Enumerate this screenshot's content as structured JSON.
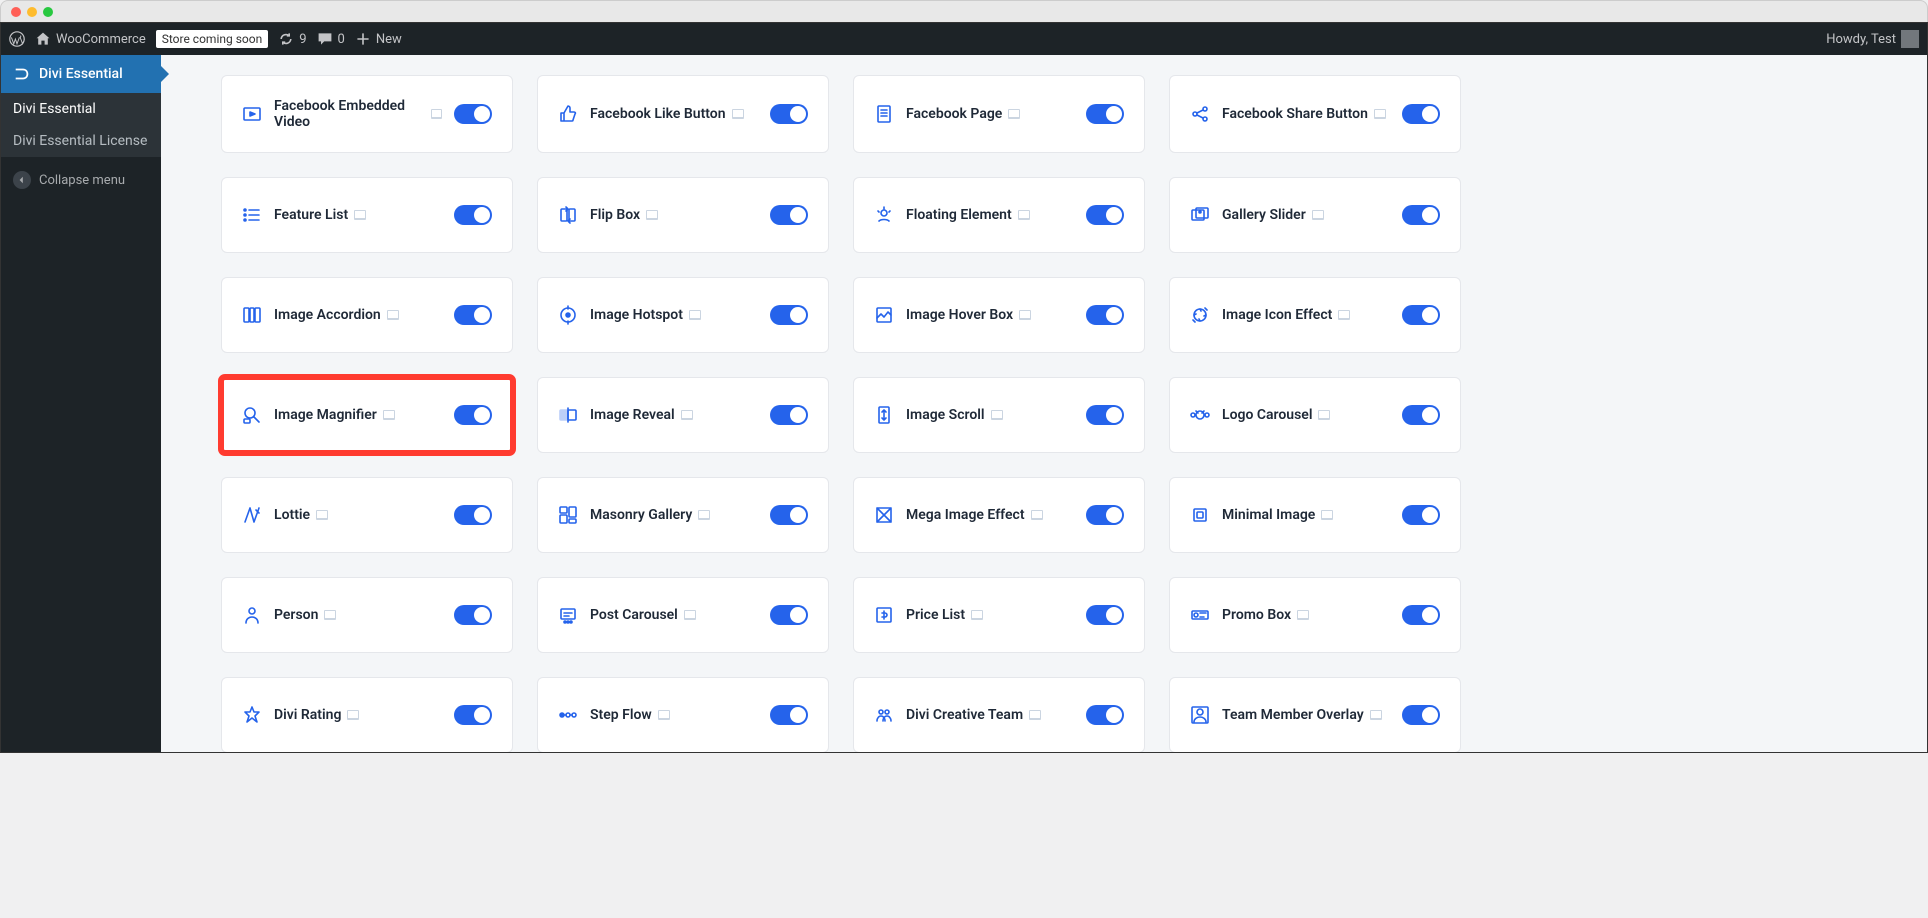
{
  "adminbar": {
    "site_title": "WooCommerce",
    "store_status": "Store coming soon",
    "updates_count": "9",
    "comments_count": "0",
    "new_label": "New",
    "howdy": "Howdy, Test"
  },
  "sidebar": {
    "header": "Divi Essential",
    "items": [
      {
        "name": "divi-essential",
        "label": "Divi Essential",
        "active": true
      },
      {
        "name": "divi-essential-license",
        "label": "Divi Essential License",
        "active": false
      }
    ],
    "collapse_label": "Collapse menu"
  },
  "modules": [
    {
      "name": "facebook-embedded-video",
      "label": "Facebook Embedded Video",
      "icon": "video",
      "enabled": true
    },
    {
      "name": "facebook-like-button",
      "label": "Facebook Like Button",
      "icon": "thumbs-up",
      "enabled": true
    },
    {
      "name": "facebook-page",
      "label": "Facebook Page",
      "icon": "page",
      "enabled": true
    },
    {
      "name": "facebook-share-button",
      "label": "Facebook Share Button",
      "icon": "share",
      "enabled": true
    },
    {
      "name": "feature-list",
      "label": "Feature List",
      "icon": "list",
      "enabled": true
    },
    {
      "name": "flip-box",
      "label": "Flip Box",
      "icon": "flip",
      "enabled": true
    },
    {
      "name": "floating-element",
      "label": "Floating Element",
      "icon": "float",
      "enabled": true
    },
    {
      "name": "gallery-slider",
      "label": "Gallery Slider",
      "icon": "gallery",
      "enabled": true
    },
    {
      "name": "image-accordion",
      "label": "Image Accordion",
      "icon": "image-acc",
      "enabled": true
    },
    {
      "name": "image-hotspot",
      "label": "Image Hotspot",
      "icon": "hotspot",
      "enabled": true
    },
    {
      "name": "image-hover-box",
      "label": "Image Hover Box",
      "icon": "hover-box",
      "enabled": true
    },
    {
      "name": "image-icon-effect",
      "label": "Image Icon Effect",
      "icon": "icon-fx",
      "enabled": true
    },
    {
      "name": "image-magnifier",
      "label": "Image Magnifier",
      "icon": "magnifier",
      "enabled": true,
      "highlighted": true
    },
    {
      "name": "image-reveal",
      "label": "Image Reveal",
      "icon": "reveal",
      "enabled": true
    },
    {
      "name": "image-scroll",
      "label": "Image Scroll",
      "icon": "scroll",
      "enabled": true
    },
    {
      "name": "logo-carousel",
      "label": "Logo Carousel",
      "icon": "carousel",
      "enabled": true
    },
    {
      "name": "lottie",
      "label": "Lottie",
      "icon": "lottie",
      "enabled": true
    },
    {
      "name": "masonry-gallery",
      "label": "Masonry Gallery",
      "icon": "masonry",
      "enabled": true
    },
    {
      "name": "mega-image-effect",
      "label": "Mega Image Effect",
      "icon": "mega",
      "enabled": true
    },
    {
      "name": "minimal-image",
      "label": "Minimal Image",
      "icon": "minimal",
      "enabled": true
    },
    {
      "name": "person",
      "label": "Person",
      "icon": "person",
      "enabled": true
    },
    {
      "name": "post-carousel",
      "label": "Post Carousel",
      "icon": "post-car",
      "enabled": true
    },
    {
      "name": "price-list",
      "label": "Price List",
      "icon": "price",
      "enabled": true
    },
    {
      "name": "promo-box",
      "label": "Promo Box",
      "icon": "promo",
      "enabled": true
    },
    {
      "name": "divi-rating",
      "label": "Divi Rating",
      "icon": "rating",
      "enabled": true
    },
    {
      "name": "step-flow",
      "label": "Step Flow",
      "icon": "step",
      "enabled": true
    },
    {
      "name": "divi-creative-team",
      "label": "Divi Creative Team",
      "icon": "team",
      "enabled": true
    },
    {
      "name": "team-member-overlay",
      "label": "Team Member Overlay",
      "icon": "team-overlay",
      "enabled": true
    }
  ]
}
